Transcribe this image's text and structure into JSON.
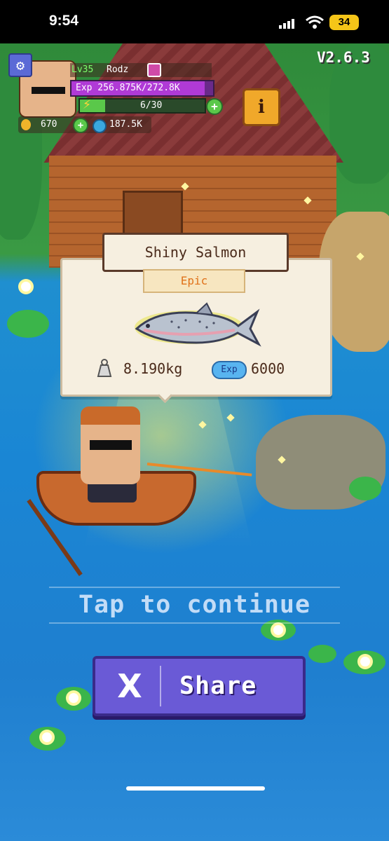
{
  "status_bar": {
    "time": "9:54",
    "battery": "34"
  },
  "game": {
    "version": "V2.6.3"
  },
  "player": {
    "level": "Lv35",
    "name": "Rodz",
    "exp_text": "Exp 256.875K/272.8K",
    "exp_fraction": 0.94,
    "energy_text": "6/30",
    "energy_fraction": 0.2,
    "coins": "670",
    "gems": "187.5K"
  },
  "catch": {
    "fish_name": "Shiny Salmon",
    "rarity": "Epic",
    "rarity_color": "#e0721a",
    "weight": "8.190kg",
    "exp_label": "Exp",
    "exp_value": "6000"
  },
  "prompt": {
    "tap_text": "Tap to continue"
  },
  "share": {
    "label": "Share",
    "logo": "X"
  },
  "icons": [
    "settings-icon",
    "info-icon",
    "coin-icon",
    "gem-icon",
    "energy-icon",
    "plus-icon",
    "weight-scale-icon",
    "x-logo-icon",
    "fish-icon"
  ]
}
